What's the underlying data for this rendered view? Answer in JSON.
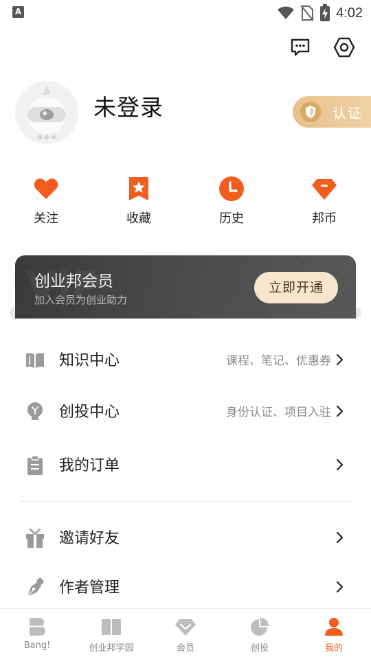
{
  "status_bar": {
    "left_icon_text": "A",
    "time": "4:02",
    "icons": [
      "wifi-icon",
      "no-sim-icon",
      "battery-charging-icon"
    ]
  },
  "top_actions": [
    "message-icon",
    "settings-icon"
  ],
  "profile": {
    "username": "未登录",
    "avatar": "robot-avatar",
    "verify_label": "认证"
  },
  "quick_actions": [
    {
      "label": "关注",
      "icon": "heart-icon"
    },
    {
      "label": "收藏",
      "icon": "bookmark-star-icon"
    },
    {
      "label": "历史",
      "icon": "clock-icon"
    },
    {
      "label": "邦币",
      "icon": "gem-coin-icon"
    }
  ],
  "vip": {
    "title": "创业邦会员",
    "subtitle": "加入会员为创业助力",
    "button": "立即开通"
  },
  "menu": [
    {
      "title": "知识中心",
      "subtitle": "课程、笔记、优惠券",
      "icon": "book-icon"
    },
    {
      "title": "创投中心",
      "subtitle": "身份认证、项目入驻",
      "icon": "bulb-icon"
    },
    {
      "title": "我的订单",
      "subtitle": "",
      "icon": "clipboard-icon"
    },
    {
      "title": "邀请好友",
      "subtitle": "",
      "icon": "gift-icon"
    },
    {
      "title": "作者管理",
      "subtitle": "",
      "icon": "pen-icon"
    }
  ],
  "bottom_nav": [
    {
      "label": "Bang!",
      "icon": "bang-logo-icon",
      "active": false
    },
    {
      "label": "创业邦学园",
      "icon": "open-book-icon",
      "active": false
    },
    {
      "label": "会员",
      "icon": "diamond-icon",
      "active": false
    },
    {
      "label": "创投",
      "icon": "pie-chart-icon",
      "active": false
    },
    {
      "label": "我的",
      "icon": "person-icon",
      "active": true
    }
  ],
  "colors": {
    "accent": "#f25c1c",
    "icon_gray": "#9a9a9a",
    "gold": "#e7c18a",
    "vip_dark": "#444444"
  }
}
